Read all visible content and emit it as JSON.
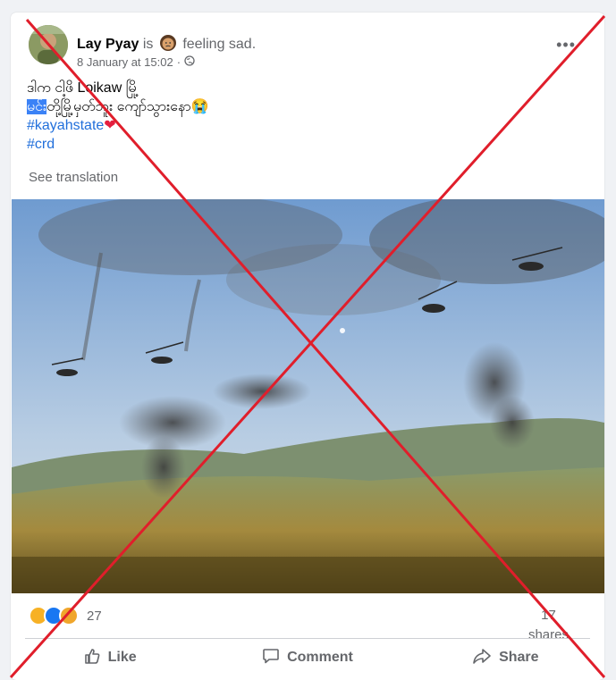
{
  "post": {
    "author": "Lay Pyay",
    "is_text": "is",
    "feeling_text": "feeling sad.",
    "timestamp": "8 January at 15:02",
    "separator": "·",
    "more_label": "•••",
    "line1": "ဒါက ငါ့ဖိ Loikaw မြို့",
    "line2_highlight": "မင်း",
    "line2_rest": "တို့မြို့မှတ်ဘူး ကျော်သွားနော😭",
    "hashtag1": "#kayahstate",
    "hashtag2": "#crd",
    "heart": "❤",
    "see_translation": "See translation"
  },
  "engagement": {
    "reaction_count": "27",
    "shares_count": "17",
    "shares_label": "shares"
  },
  "actions": {
    "like": "Like",
    "comment": "Comment",
    "share": "Share"
  },
  "colors": {
    "link": "#216fdb",
    "overlay_cross": "#e01e2b",
    "muted": "#65676b"
  }
}
